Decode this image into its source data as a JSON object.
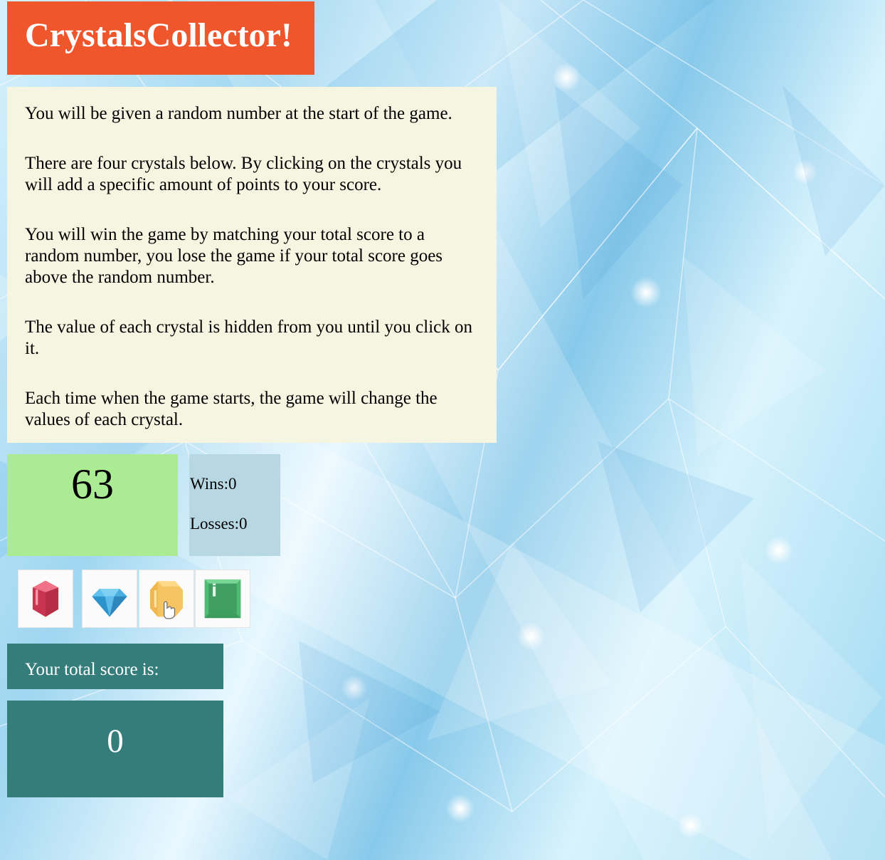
{
  "header": {
    "title": "CrystalsCollector!"
  },
  "instructions": {
    "paragraphs": [
      "You will be given a random number at the start of the game.",
      "There are four crystals below. By clicking on the crystals you will add a specific amount of points to your score.",
      "You will win the game by matching your total score to a random number, you lose the game if your total score goes above the random number.",
      "The value of each crystal is hidden from you until you click on it.",
      "Each time when the game starts, the game will change the values of each crystal."
    ]
  },
  "game": {
    "target_number": "63",
    "wins_label": "Wins:",
    "wins": "0",
    "losses_label": "Losses:",
    "losses": "0",
    "total_label": "Your total score is:",
    "total_score": "0"
  },
  "crystals": [
    {
      "icon": "red-crystal-icon",
      "color": "#d8455f"
    },
    {
      "icon": "blue-diamond-icon",
      "color": "#3fa6dd"
    },
    {
      "icon": "yellow-crystal-icon",
      "color": "#f5c463"
    },
    {
      "icon": "green-crystal-icon",
      "color": "#4dbd73"
    }
  ],
  "colors": {
    "header_bg": "#f0562c",
    "instructions_bg": "#f5f5e1",
    "target_bg": "#aaeb93",
    "stats_bg": "#b7d7e3",
    "score_bg": "#357d7b"
  }
}
